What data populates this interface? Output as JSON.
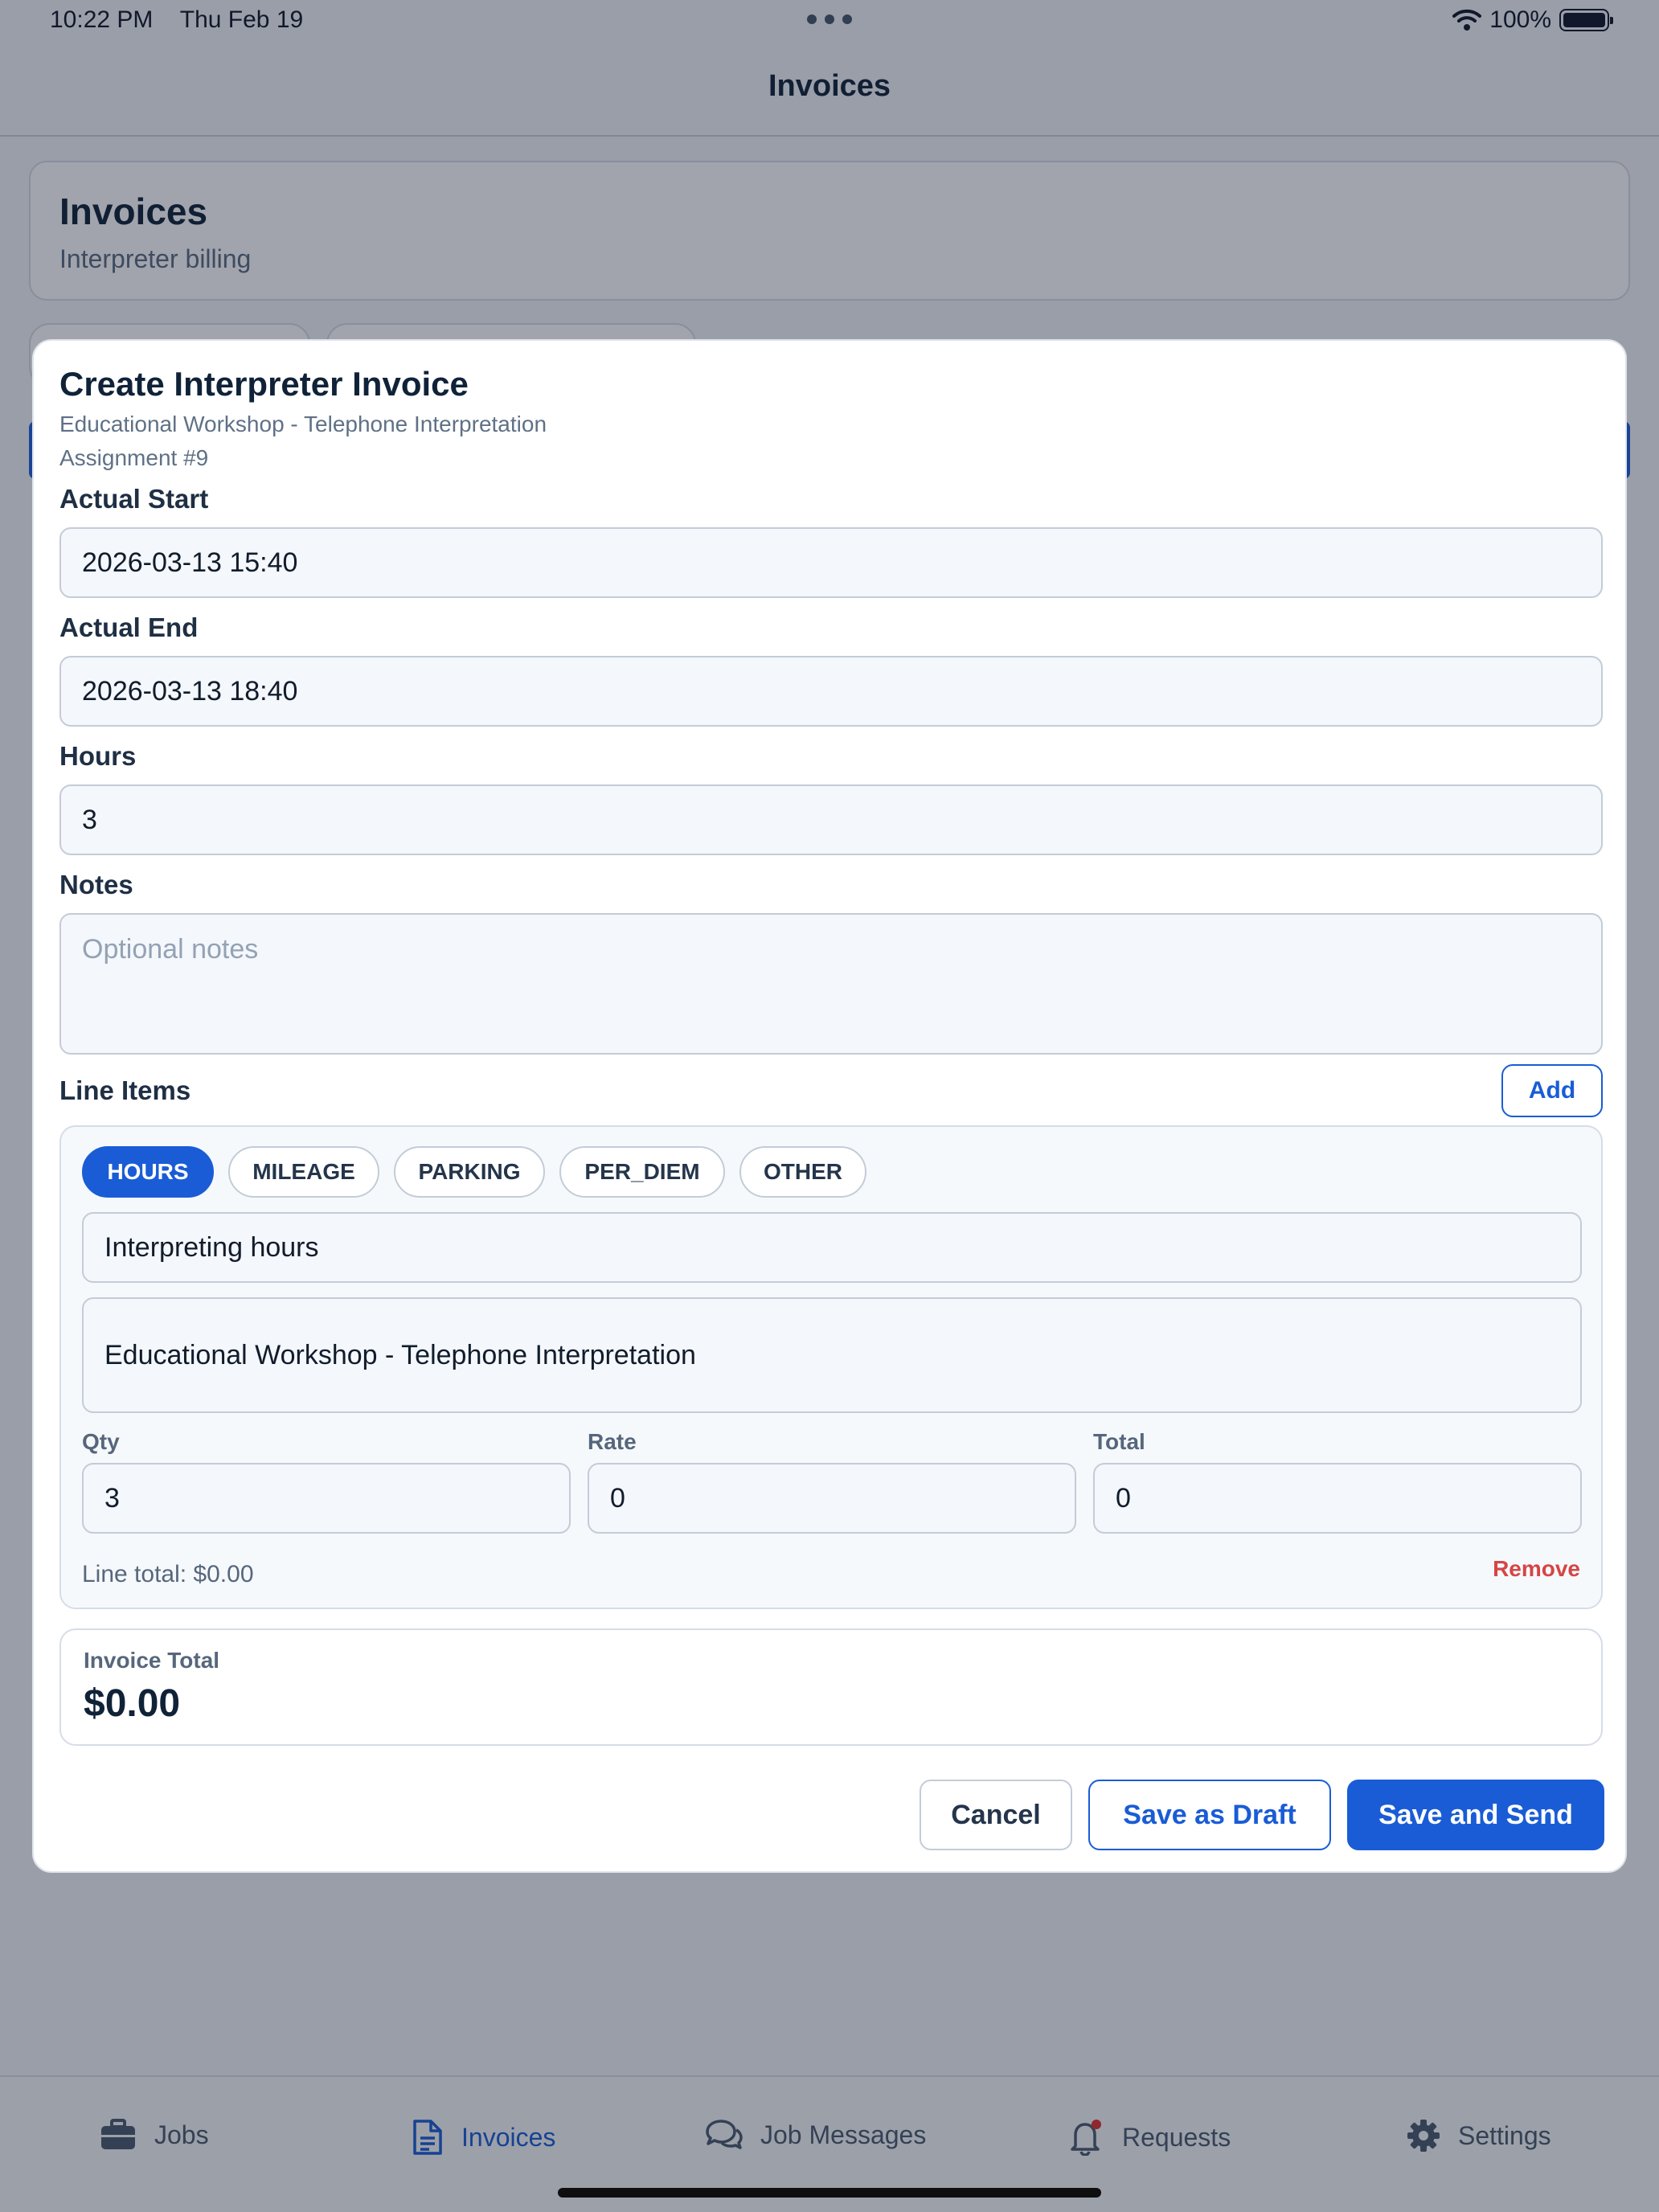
{
  "status_bar": {
    "time": "10:22 PM",
    "date": "Thu Feb 19",
    "battery": "100%"
  },
  "nav": {
    "title": "Invoices"
  },
  "header": {
    "title": "Invoices",
    "subtitle": "Interpreter billing"
  },
  "modal": {
    "title": "Create Interpreter Invoice",
    "subtitle": "Educational Workshop - Telephone Interpretation",
    "assignment": "Assignment #9",
    "actual_start": {
      "label": "Actual Start",
      "value": "2026-03-13 15:40"
    },
    "actual_end": {
      "label": "Actual End",
      "value": "2026-03-13 18:40"
    },
    "hours": {
      "label": "Hours",
      "value": "3"
    },
    "notes": {
      "label": "Notes",
      "placeholder": "Optional notes"
    },
    "line_items": {
      "label": "Line Items",
      "add_label": "Add",
      "types": [
        "HOURS",
        "MILEAGE",
        "PARKING",
        "PER_DIEM",
        "OTHER"
      ],
      "selected_type": "HOURS",
      "item": {
        "title": "Interpreting hours",
        "description": "Educational Workshop - Telephone Interpretation",
        "qty_label": "Qty",
        "qty": "3",
        "rate_label": "Rate",
        "rate": "0",
        "total_label": "Total",
        "total": "0",
        "line_total": "Line total: $0.00",
        "remove_label": "Remove"
      }
    },
    "invoice_total": {
      "label": "Invoice Total",
      "value": "$0.00"
    },
    "buttons": {
      "cancel": "Cancel",
      "save_draft": "Save as Draft",
      "save_send": "Save and Send"
    }
  },
  "tabs": [
    {
      "label": "Jobs",
      "icon": "briefcase-icon"
    },
    {
      "label": "Invoices",
      "icon": "document-icon",
      "active": true
    },
    {
      "label": "Job Messages",
      "icon": "chat-bubbles-icon"
    },
    {
      "label": "Requests",
      "icon": "bell-icon",
      "badge": true
    },
    {
      "label": "Settings",
      "icon": "gear-icon"
    }
  ],
  "colors": {
    "accent": "#1a5cd6",
    "danger": "#d64545",
    "badge": "#e0302d"
  }
}
